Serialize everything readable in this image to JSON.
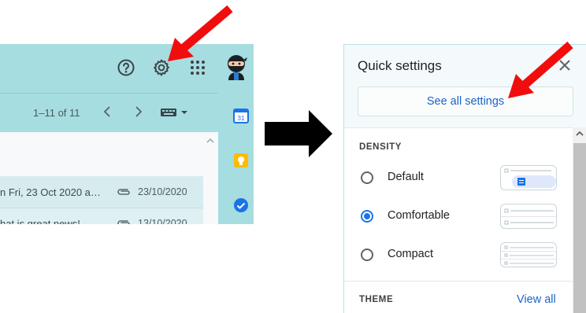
{
  "gmail": {
    "pager_text": "1–11 of 11",
    "rows": [
      {
        "subject": "n Fri, 23 Oct 2020 a…",
        "date": "23/10/2020"
      },
      {
        "subject": "hat is great news!",
        "date": "13/10/2020"
      }
    ],
    "icons": {
      "help": "help-icon",
      "settings": "gear-icon",
      "apps": "apps-grid-icon",
      "avatar": "ninja-avatar",
      "calendar": "calendar-icon",
      "keep": "keep-bulb-icon",
      "tasks": "tasks-check-icon"
    },
    "calendar_day": "31"
  },
  "quick_settings": {
    "title": "Quick settings",
    "see_all": "See all settings",
    "density_heading": "DENSITY",
    "density_options": [
      {
        "label": "Default",
        "selected": false
      },
      {
        "label": "Comfortable",
        "selected": true
      },
      {
        "label": "Compact",
        "selected": false
      }
    ],
    "theme_heading": "THEME",
    "view_all": "View all"
  },
  "colors": {
    "gmail_teal": "#a6dde0",
    "accent_blue": "#1a73e8",
    "link_blue": "#1a63c9",
    "arrow_red": "#f20d0d"
  }
}
